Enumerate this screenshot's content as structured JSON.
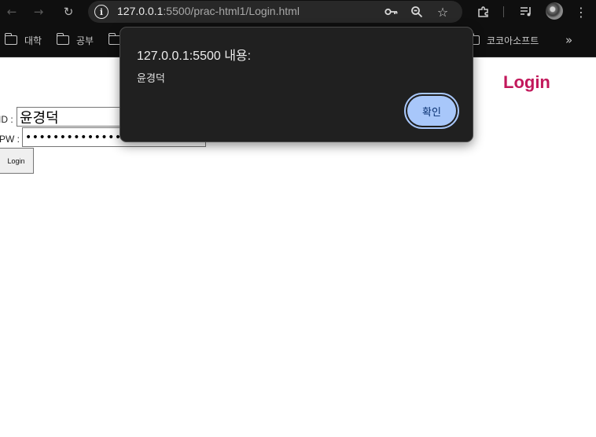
{
  "browser": {
    "url_host": "127.0.0.1",
    "url_rest": ":5500/prac-html1/Login.html",
    "bookmarks": [
      {
        "label": "대학"
      },
      {
        "label": "공부"
      },
      {
        "label": ""
      },
      {
        "label": "코코아소프트"
      }
    ],
    "icons": {
      "back": "arrow-left",
      "forward": "arrow-right",
      "reload": "reload",
      "site_info": "info",
      "password_key": "key",
      "zoom": "magnifier",
      "bookmark_star": "star",
      "extensions": "puzzle",
      "media": "music-queue",
      "menu": "kebab"
    }
  },
  "page": {
    "title": "Login",
    "title_color": "#c2185b",
    "id_label": "ID :",
    "id_value": "윤경덕",
    "pw_label": "PW :",
    "pw_value": "••••••••••••••",
    "login_button": "Login"
  },
  "dialog": {
    "title": "127.0.0.1:5500 내용:",
    "message": "윤경덕",
    "ok_button": "확인",
    "accent_color": "#a8c7fa"
  }
}
